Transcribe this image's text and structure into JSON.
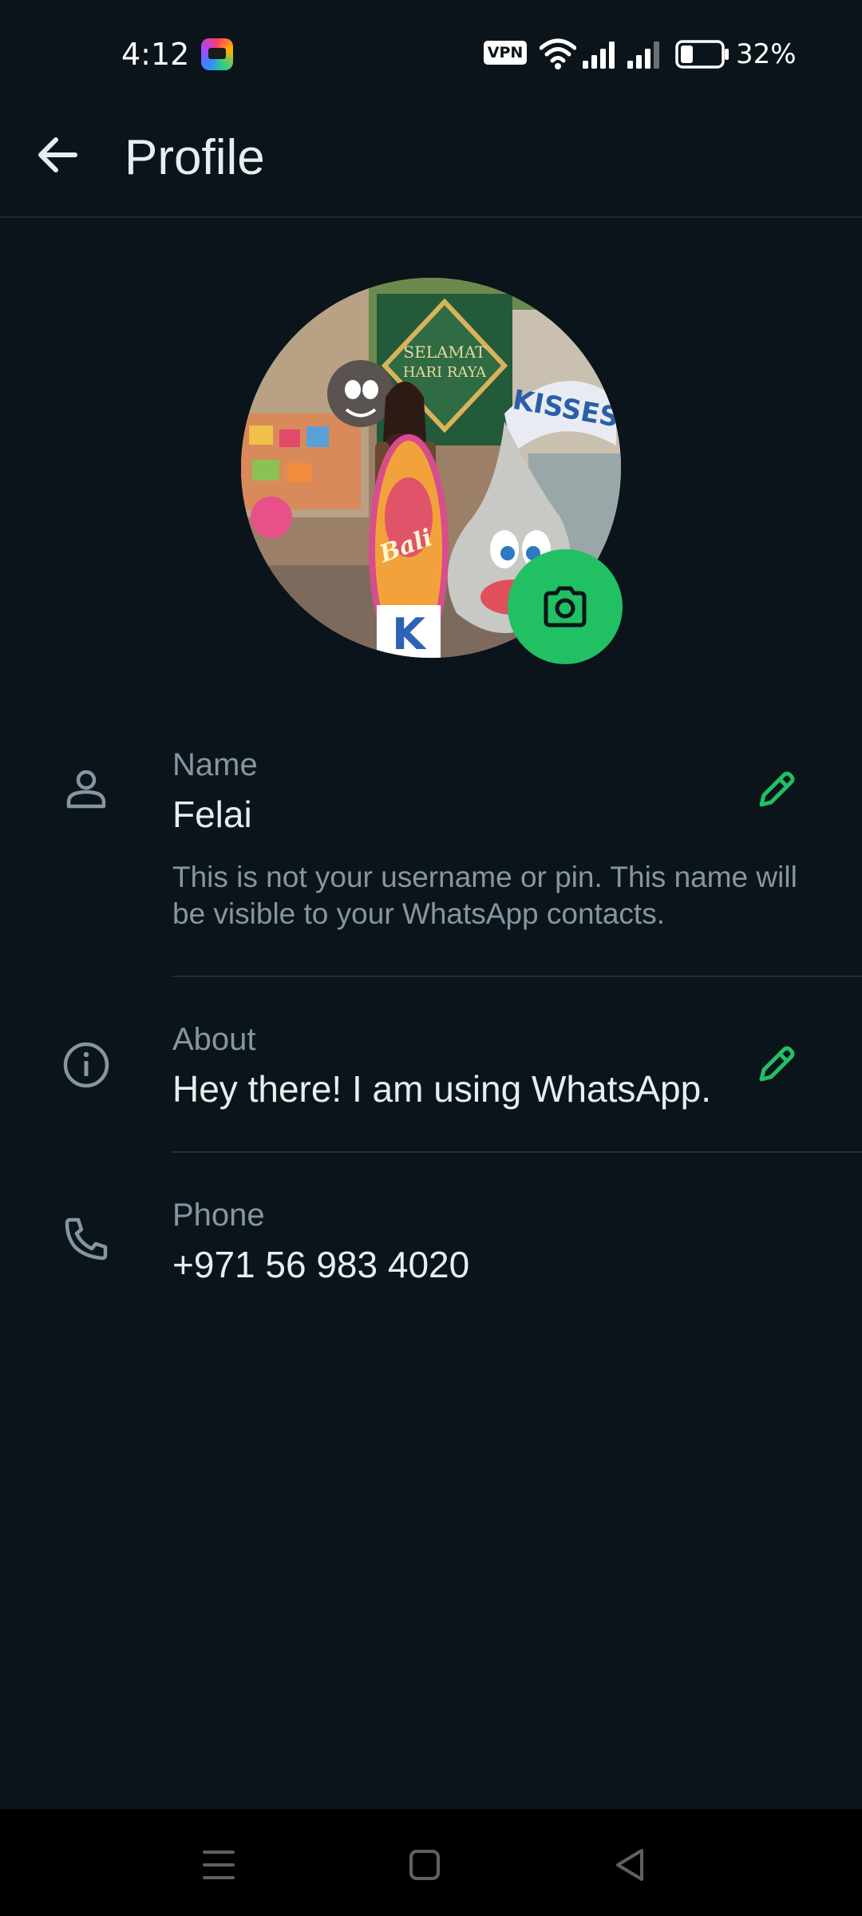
{
  "status_bar": {
    "time": "4:12",
    "vpn": "VPN",
    "battery_percent": "32%",
    "battery_level": 0.32,
    "icons": [
      "app-notification-icon",
      "vpn-icon",
      "wifi-icon",
      "signal-icon",
      "signal-icon",
      "battery-icon"
    ]
  },
  "app_bar": {
    "back_icon": "arrow-left-icon",
    "title": "Profile"
  },
  "profile": {
    "camera_icon": "camera-icon",
    "name": {
      "icon": "person-icon",
      "label": "Name",
      "value": "Felai",
      "hint": "This is not your username or pin. This name will be visible to your WhatsApp contacts.",
      "edit_icon": "pencil-icon"
    },
    "about": {
      "icon": "info-icon",
      "label": "About",
      "value": "Hey there! I am using WhatsApp.",
      "edit_icon": "pencil-icon"
    },
    "phone": {
      "icon": "phone-icon",
      "label": "Phone",
      "value": "+971 56 983 4020"
    }
  },
  "nav_bar": {
    "icons": [
      "menu-icon",
      "home-icon",
      "back-triangle-icon"
    ]
  },
  "colors": {
    "background": "#0b141a",
    "accent": "#21c063",
    "primary_text": "#e9edef",
    "secondary_text": "#8696a0",
    "divider": "#222d34",
    "nav_bar": "#000000"
  }
}
